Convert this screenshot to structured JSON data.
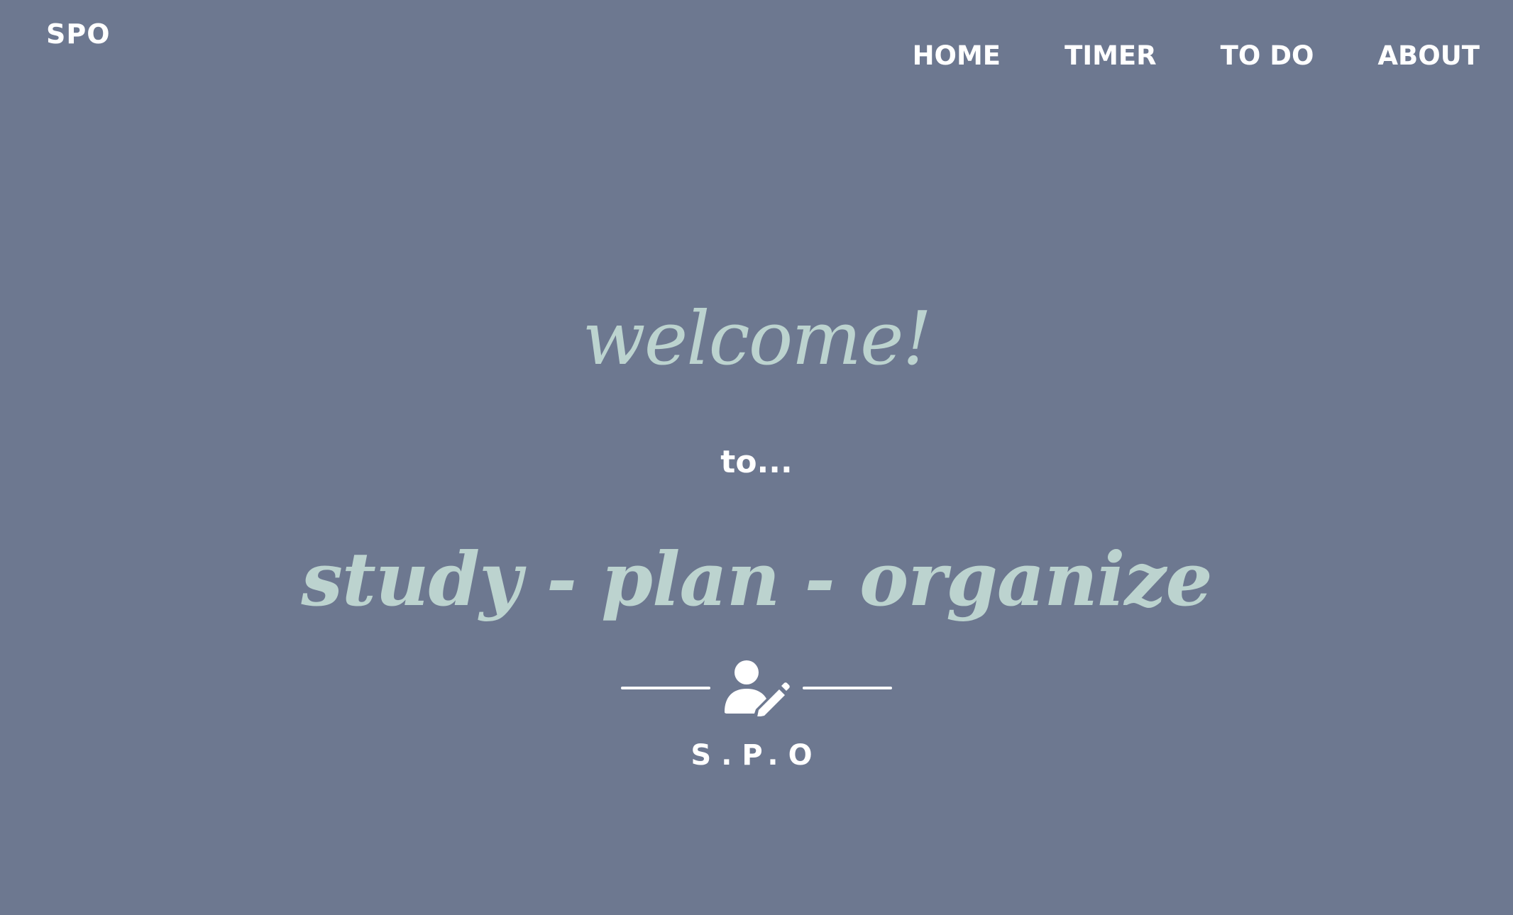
{
  "header": {
    "brand": "SPO",
    "nav": [
      {
        "label": "HOME"
      },
      {
        "label": "TIMER"
      },
      {
        "label": "TO DO"
      },
      {
        "label": "ABOUT"
      }
    ]
  },
  "hero": {
    "welcome": "welcome!",
    "to": "to...",
    "tagline": "study - plan - organize",
    "divider_icon": "user-edit-icon",
    "brand_mark": "S.P.O"
  },
  "colors": {
    "background": "#6d7890",
    "accent": "#bcd3cf",
    "text": "#ffffff"
  }
}
